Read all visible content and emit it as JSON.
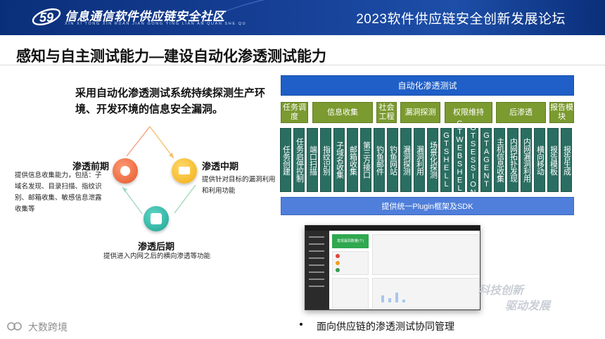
{
  "header": {
    "logo_title": "信息通信软件供应链安全社区",
    "logo_subtitle": "XIN XI TONG XIN RUAN JIAN GONG YING LIAN AN QUAN SHE QU",
    "forum_title": "2023软件供应链安全创新发展论坛"
  },
  "slide": {
    "title": "感知与自主测试能力—建设自动化渗透测试能力",
    "lead": "采用自动化渗透测试系统持续探测生产环境、开发环境的信息安全漏洞。"
  },
  "phases": {
    "early": {
      "title": "渗透前期",
      "desc": "提供信息收集能力，包括：子域名发现、目录扫描、指纹识别、邮箱收集、敏感信息泄露收集等"
    },
    "middle": {
      "title": "渗透中期",
      "desc": "提供针对目标的漏洞利用和利用功能"
    },
    "late": {
      "title": "渗透后期",
      "desc": "提供进入内网之后的横向渗透等功能"
    }
  },
  "architecture": {
    "title": "自动化渗透测试",
    "categories": [
      "任务调度",
      "信息收集",
      "社会工程",
      "漏洞探测",
      "权限维持",
      "后渗透",
      "报告模块"
    ],
    "modules": [
      "任务创建",
      "任务启停控制",
      "端口扫描",
      "指纹识别",
      "子域名收集",
      "邮箱收集",
      "第三方接口",
      "钓鱼邮件",
      "钓鱼网站",
      "漏洞探测",
      "漏洞利用",
      "场景化探测",
      "GTSHELL",
      "GTWEBSHELL",
      "GTSESSION",
      "GTAGENT",
      "主机信息收集",
      "内网拓扑发现",
      "内网漏洞利用",
      "横向移动",
      "报告模板",
      "报告生成"
    ],
    "footer": "提供统一Plugin框架及SDK"
  },
  "screenshot": {
    "banner_text": "发现漏洞数量(个)"
  },
  "watermark": {
    "line1": "科技创新",
    "line2": "驱动发展"
  },
  "bullet": "面向供应链的渗透测试协同管理",
  "brand": "大数跨境",
  "colors": {
    "header_bg": "#163f95",
    "arch_head": "#1f5fc7",
    "category": "#7b9a2f",
    "module": "#2a6e62",
    "arch_foot": "#4f7fdb",
    "phase_early": "#e4572a",
    "phase_middle": "#f2ae13",
    "phase_late": "#1fa392"
  }
}
